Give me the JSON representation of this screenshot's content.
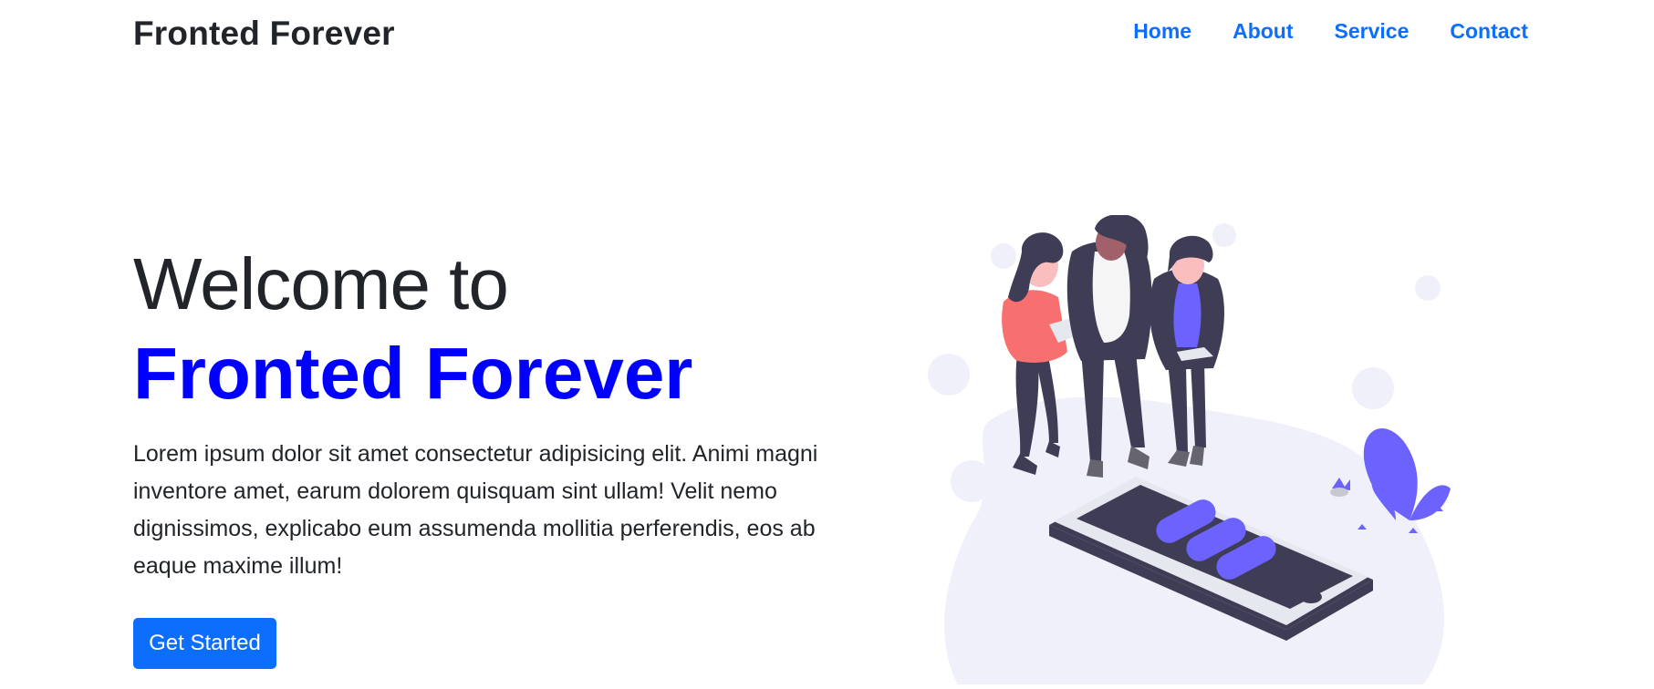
{
  "nav": {
    "brand": "Fronted Forever",
    "links": [
      "Home",
      "About",
      "Service",
      "Contact"
    ]
  },
  "hero": {
    "welcome": "Welcome to",
    "brand": "Fronted Forever",
    "lead": "Lorem ipsum dolor sit amet consectetur adipisicing elit. Animi magni inventore amet, earum dolorem quisquam sint ullam! Velit nemo dignissimos, explicabo eum assumenda mollitia perferendis, eos ab eaque maxime illum!",
    "cta": "Get Started"
  },
  "colors": {
    "primary": "#0d6efd",
    "heading_accent": "#0000ff",
    "illustration_purple": "#6c63ff",
    "illustration_bg": "#f0f0fb",
    "illustration_dark": "#3f3d56"
  },
  "icons": {
    "illustration": "people-with-phone-illustration"
  }
}
